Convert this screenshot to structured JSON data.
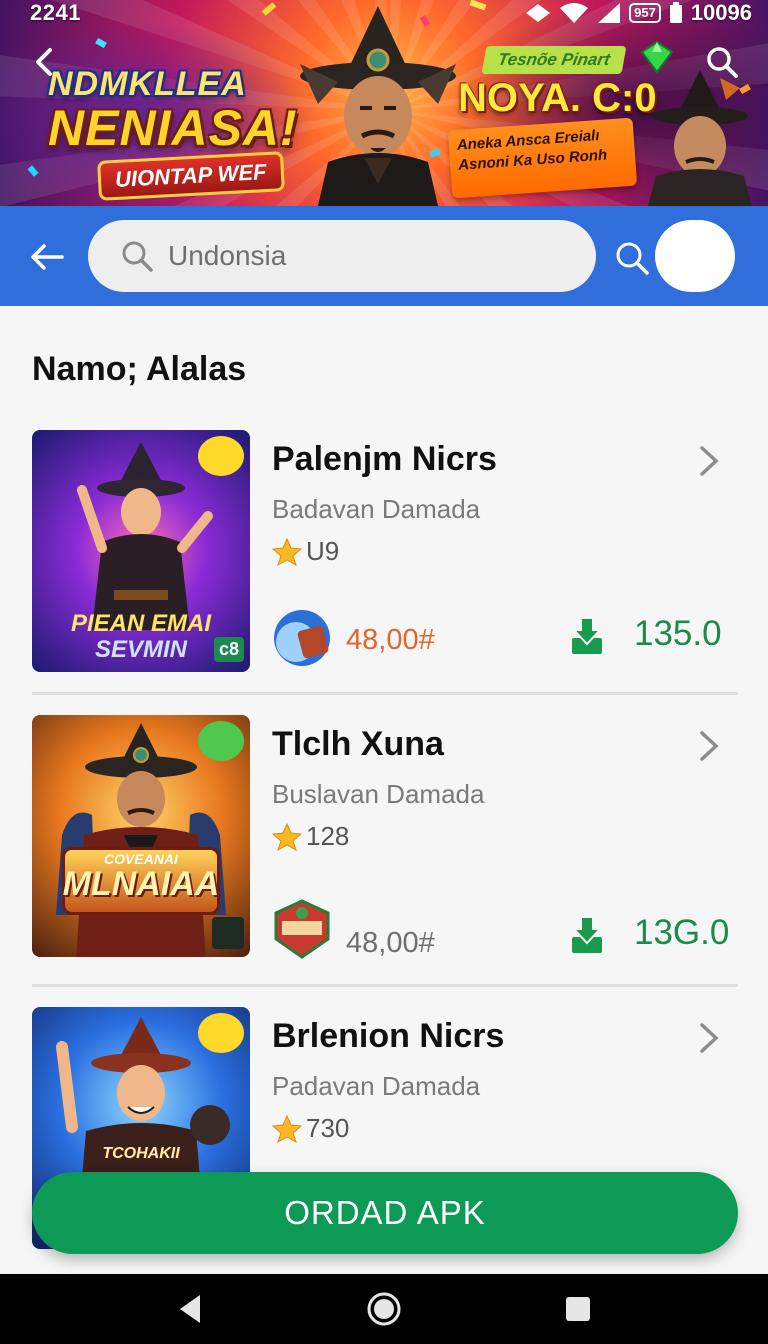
{
  "status_bar": {
    "time": "2241",
    "battery_badge": "957",
    "clock": "10096"
  },
  "banner": {
    "logo_line1": "NDMKLLEA",
    "logo_line2": "NENIASA!",
    "logo_ribbon": "UIONTAP WEF",
    "promo_tag": "Tesnõe Pinart",
    "promo_title": "NOYA. C:0",
    "promo_lines": [
      "Aneka Ansca Ereialı",
      "Asnoni Ka Uso Ronh"
    ]
  },
  "search": {
    "value": "Undonsia"
  },
  "section": {
    "title": "Namo; Alalas"
  },
  "apps": [
    {
      "name": "Palenjm Nicrs",
      "developer": "Badavan Damada",
      "rating": "U9",
      "price": "48,00#",
      "price_color": "#e0662a",
      "downloads": "135.0",
      "thumb_title_1": "PIEAN EMAI",
      "thumb_title_2": "SEVMIN",
      "thumb_badge": "c8"
    },
    {
      "name": "Tlclh Xuna",
      "developer": "Buslavan Damada",
      "rating": "128",
      "price": "48,00#",
      "price_color": "#6f6f6f",
      "downloads": "13G.0",
      "thumb_title_1": "COVEANAI",
      "thumb_title_2": "MLNAIAA"
    },
    {
      "name": "Brlenion Nicrs",
      "developer": "Padavan Damada",
      "rating": "730",
      "thumb_title_1": "TCOHAKII"
    }
  ],
  "cta": {
    "label": "ORDAD APK"
  },
  "colors": {
    "header_blue": "#2f6edb",
    "accent_green": "#0d9a57",
    "download_green": "#1a8a4e",
    "price_orange": "#e0662a"
  },
  "icons": {
    "back": "back-arrow-icon",
    "search": "search-icon",
    "chevron": "chevron-right-icon",
    "star": "star-icon",
    "download": "download-icon",
    "nav_back": "nav-back-icon",
    "nav_home": "nav-home-icon",
    "nav_recents": "nav-recents-icon"
  }
}
